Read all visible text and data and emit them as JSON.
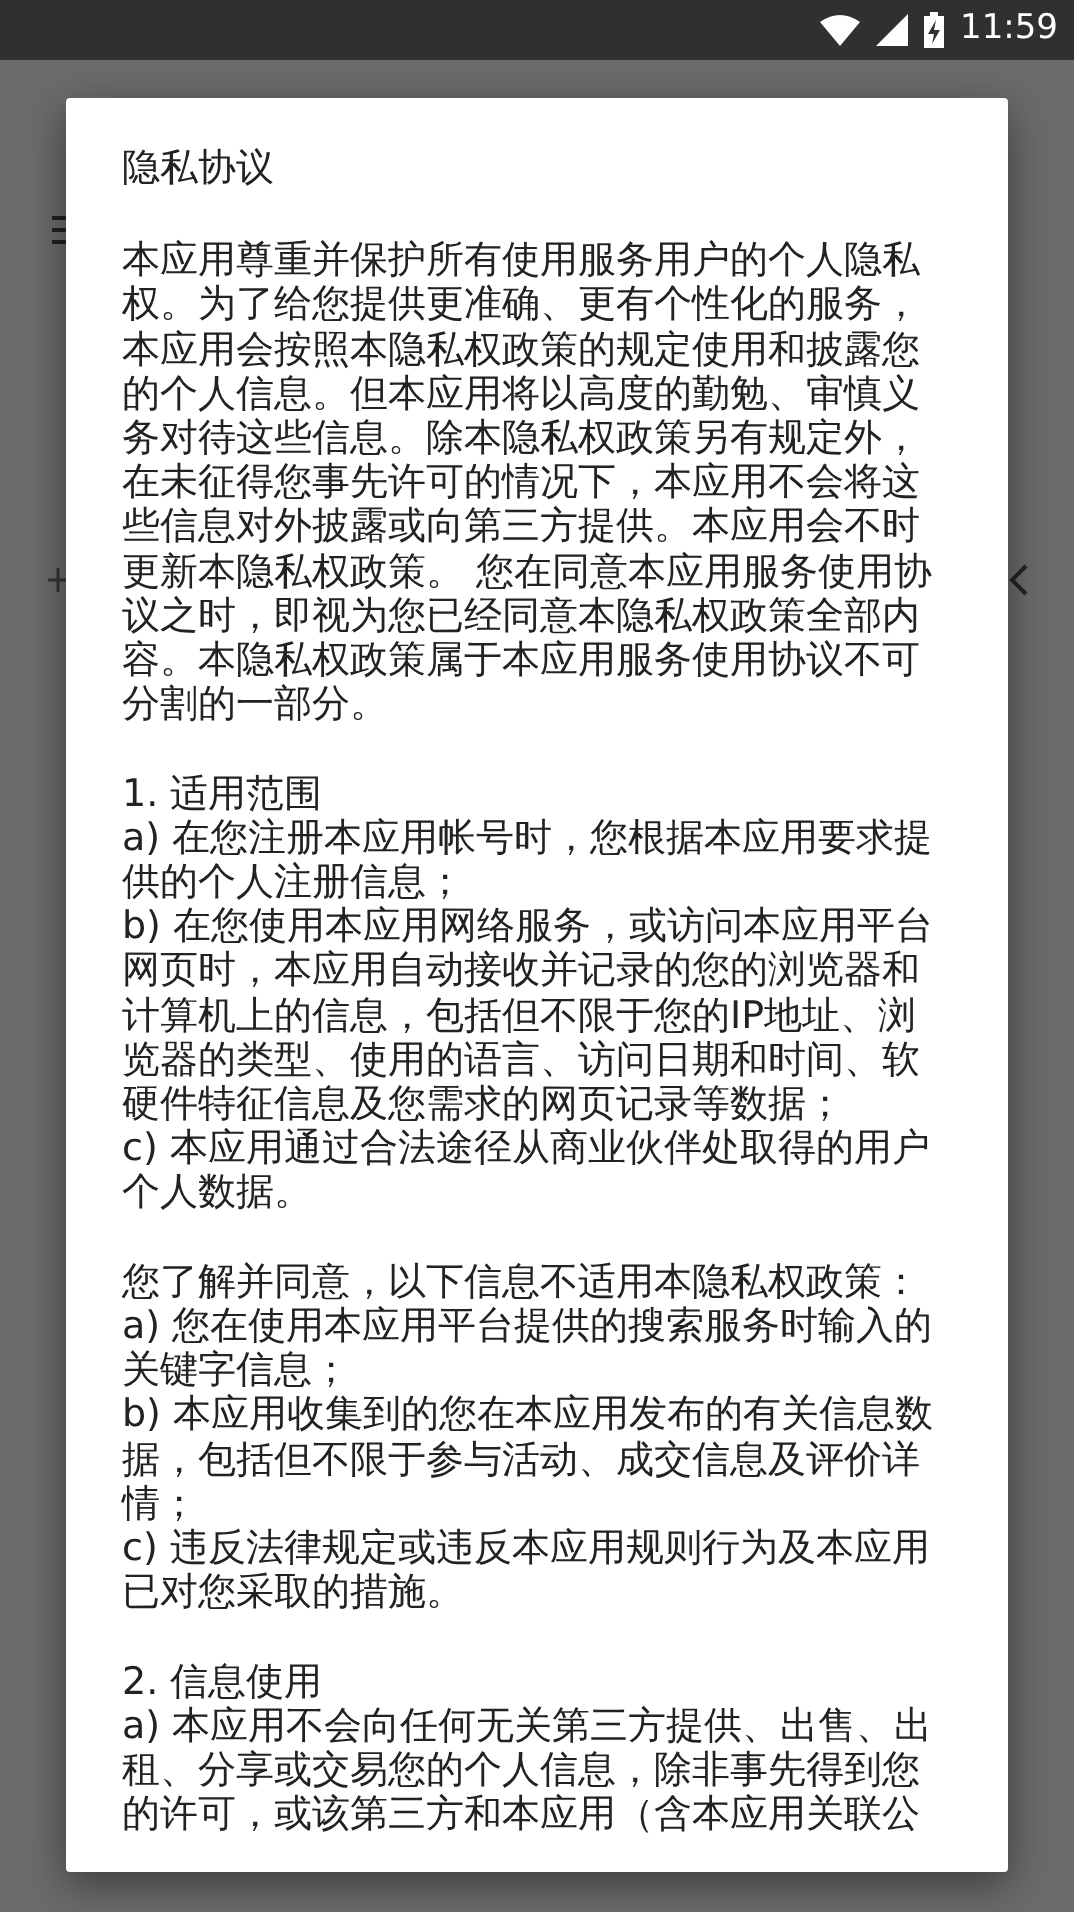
{
  "status_bar": {
    "time": "11:59"
  },
  "dialog": {
    "title": "隐私协议",
    "paragraphs": [
      {
        "lines": [
          "本应用尊重并保护所有使用服务用户的个人隐私",
          "权。为了给您提供更准确、更有个性化的服务，",
          "本应用会按照本隐私权政策的规定使用和披露您",
          "的个人信息。但本应用将以高度的勤勉、审慎义",
          "务对待这些信息。除本隐私权政策另有规定外，",
          "在未征得您事先许可的情况下，本应用不会将这",
          "些信息对外披露或向第三方提供。本应用会不时",
          "更新本隐私权政策。 您在同意本应用服务使用协",
          "议之时，即视为您已经同意本隐私权政策全部内",
          "容。本隐私权政策属于本应用服务使用协议不可",
          "分割的一部分。"
        ]
      },
      {
        "lines": [
          "1. 适用范围",
          "a) 在您注册本应用帐号时，您根据本应用要求提",
          "供的个人注册信息；",
          "b) 在您使用本应用网络服务，或访问本应用平台",
          "网页时，本应用自动接收并记录的您的浏览器和",
          "计算机上的信息，包括但不限于您的IP地址、浏",
          "览器的类型、使用的语言、访问日期和时间、软",
          "硬件特征信息及您需求的网页记录等数据；",
          "c) 本应用通过合法途径从商业伙伴处取得的用户",
          "个人数据。"
        ]
      },
      {
        "lines": [
          "您了解并同意，以下信息不适用本隐私权政策：",
          "a) 您在使用本应用平台提供的搜索服务时输入的",
          "关键字信息；",
          "b) 本应用收集到的您在本应用发布的有关信息数",
          "据，包括但不限于参与活动、成交信息及评价详",
          "情；",
          "c) 违反法律规定或违反本应用规则行为及本应用",
          "已对您采取的措施。"
        ]
      },
      {
        "lines": [
          "2. 信息使用",
          "a) 本应用不会向任何无关第三方提供、出售、出",
          "租、分享或交易您的个人信息，除非事先得到您",
          "的许可，或该第三方和本应用（含本应用关联公"
        ]
      }
    ]
  }
}
